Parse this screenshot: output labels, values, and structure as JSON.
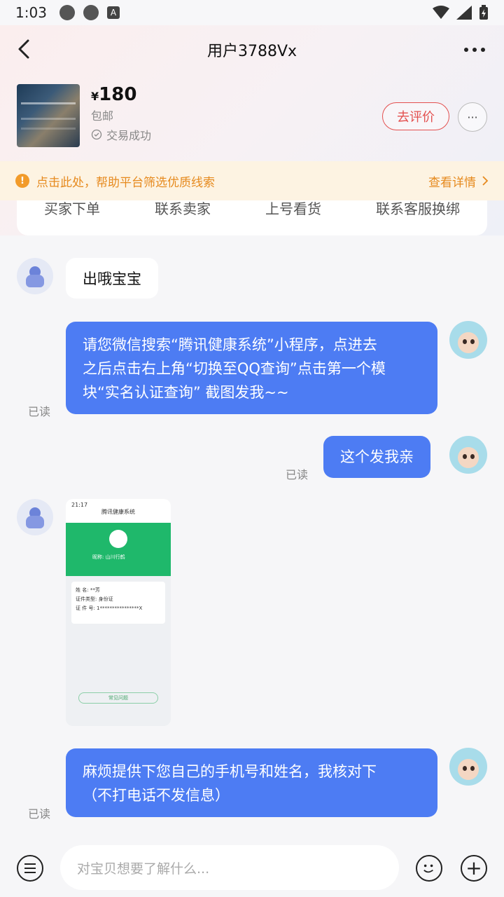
{
  "status_bar": {
    "time": "1:03",
    "a_label": "A"
  },
  "header": {
    "title": "用户3788Vx"
  },
  "product": {
    "currency": "¥",
    "price": "180",
    "shipping": "包邮",
    "deal_status": "交易成功",
    "review_button": "去评价",
    "more": "···"
  },
  "notice": {
    "text": "点击此处，帮助平台筛选优质线索",
    "more": "查看详情"
  },
  "quick_actions": [
    "买家下单",
    "联系卖家",
    "上号看货",
    "联系客服换绑"
  ],
  "messages": [
    {
      "side": "left",
      "text": "出哦宝宝"
    },
    {
      "side": "right",
      "lines": [
        "请您微信搜索“腾讯健康系统”小程序，点进去",
        "之后点击右上角“切换至QQ查询”点击第一个模",
        "块“实名认证查询” 截图发我~~"
      ],
      "read": "已读"
    },
    {
      "side": "right",
      "text": "这个发我亲",
      "read": "已读"
    },
    {
      "side": "left",
      "type": "image",
      "image": {
        "time": "21:17",
        "title": "腾讯健康系统",
        "nickname": "昵称: 山川行鹤",
        "name_label": "姓",
        "name_label2": "名:",
        "name_value": "**芳",
        "id_type_label": "证件类型:",
        "id_type_value": "身份证",
        "id_no_label": "证 件 号:",
        "id_no_value": "1****************X",
        "faq": "常见问题"
      }
    },
    {
      "side": "right",
      "lines": [
        "麻烦提供下您自己的手机号和姓名，我核对下",
        "（不打电话不发信息）"
      ],
      "read": "已读"
    }
  ],
  "input_bar": {
    "placeholder": "对宝贝想要了解什么..."
  }
}
